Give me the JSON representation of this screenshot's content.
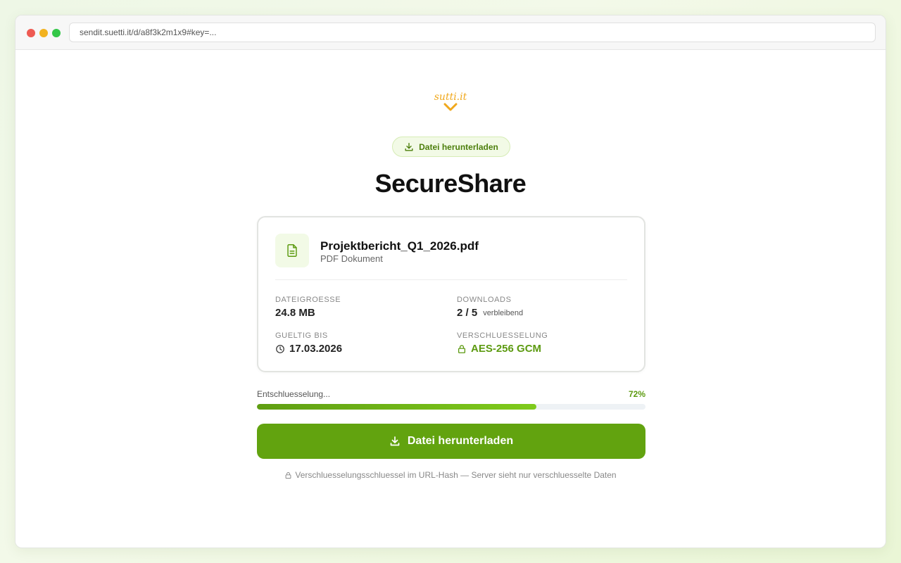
{
  "browser": {
    "url": "sendit.suetti.it/d/a8f3k2m1x9#key=..."
  },
  "logo": {
    "text": "sutti.it"
  },
  "badge": {
    "label": "Datei herunterladen",
    "icon": "download-icon"
  },
  "page_title": "SecureShare",
  "file": {
    "name": "Projektbericht_Q1_2026.pdf",
    "type": "PDF Dokument",
    "icon": "file-icon"
  },
  "meta": {
    "size_label": "DATEIGROESSE",
    "size_value": "24.8 MB",
    "downloads_label": "DOWNLOADS",
    "downloads_value": "2 / 5",
    "downloads_suffix": "verbleibend",
    "valid_label": "GUELTIG BIS",
    "valid_value": "17.03.2026",
    "valid_icon": "clock-icon",
    "encryption_label": "VERSCHLUESSELUNG",
    "encryption_value": "AES-256 GCM",
    "encryption_icon": "lock-icon"
  },
  "progress": {
    "label": "Entschluesselung...",
    "percent_text": "72%",
    "value": 0.72
  },
  "download_button": {
    "label": "Datei herunterladen",
    "icon": "download-icon"
  },
  "footnote": {
    "text": "Verschluesselungsschluessel im URL-Hash — Server sieht nur verschluesselte Daten",
    "icon": "lock-icon"
  },
  "colors": {
    "accent": "#62a30f",
    "accent_text": "#5c9a10",
    "logo": "#f0a81c",
    "badge_bg": "#f2fae6"
  }
}
